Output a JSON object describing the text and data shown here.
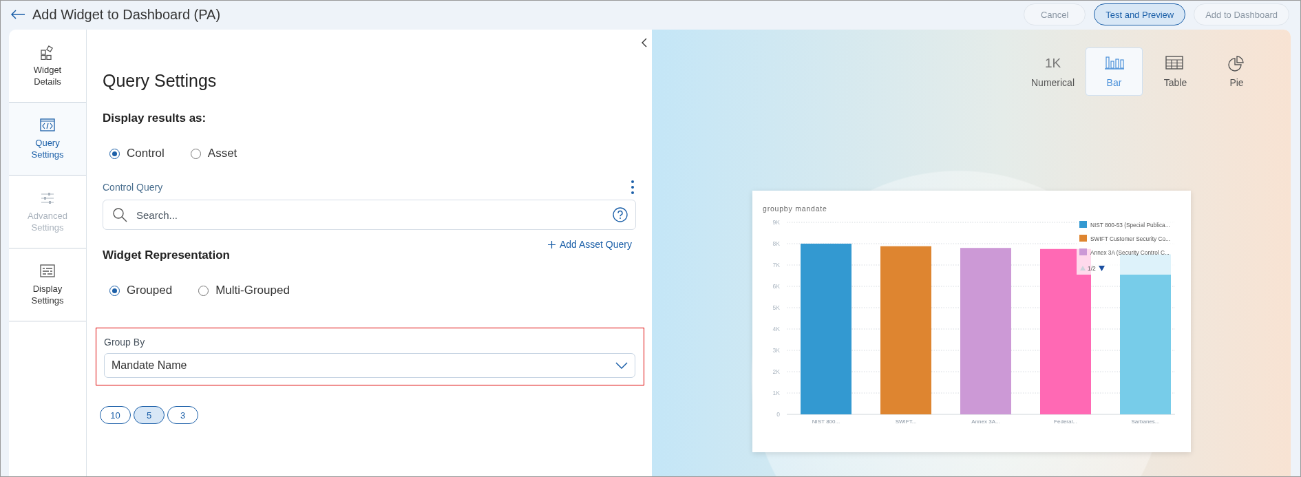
{
  "header": {
    "title": "Add Widget to Dashboard (PA)",
    "buttons": [
      {
        "label": "Cancel",
        "kind": "outline",
        "disabled": true
      },
      {
        "label": "Test and Preview",
        "kind": "primary",
        "disabled": false
      },
      {
        "label": "Add to Dashboard",
        "kind": "outline",
        "disabled": true
      }
    ]
  },
  "sidebar": {
    "items": [
      {
        "label": "Widget Details",
        "kind": "widgets",
        "selected": false,
        "disabled": false
      },
      {
        "label": "Query Settings",
        "kind": "code",
        "selected": true,
        "disabled": false
      },
      {
        "label": "Advanced Settings",
        "kind": "sliders",
        "selected": false,
        "disabled": true
      },
      {
        "label": "Display Settings",
        "kind": "list",
        "selected": false,
        "disabled": false
      }
    ]
  },
  "query_panel": {
    "title": "Query Settings",
    "display_results": {
      "label": "Display results as:",
      "options": [
        {
          "label": "Control",
          "selected": true
        },
        {
          "label": "Asset",
          "selected": false
        }
      ]
    },
    "control_query": {
      "label": "Control Query",
      "placeholder": "Search..."
    },
    "add_asset_query": "Add Asset Query",
    "widget_representation": {
      "label": "Widget Representation",
      "options": [
        {
          "label": "Grouped",
          "selected": true
        },
        {
          "label": "Multi-Grouped",
          "selected": false
        }
      ]
    },
    "group_by": {
      "label": "Group By",
      "value": "Mandate Name"
    },
    "limits": [
      {
        "label": "10",
        "selected": false
      },
      {
        "label": "5",
        "selected": true
      },
      {
        "label": "3",
        "selected": false
      }
    ]
  },
  "preview": {
    "chart_types": [
      {
        "label": "Numerical",
        "icon_text": "1K",
        "kind": "numerical",
        "selected": false
      },
      {
        "label": "Bar",
        "kind": "bar",
        "selected": true
      },
      {
        "label": "Table",
        "kind": "table",
        "selected": false
      },
      {
        "label": "Pie",
        "kind": "pie",
        "selected": false
      }
    ],
    "chart_data": {
      "type": "bar",
      "title": "groupby mandate",
      "categories": [
        "NIST 800...",
        "SWIFT...",
        "Annex 3A...",
        "Federal...",
        "Sarbanes..."
      ],
      "series": [
        {
          "color": "#3399d1",
          "values": [
            8000,
            null,
            null,
            null,
            null
          ]
        },
        {
          "color": "#de8530",
          "values": [
            null,
            7880,
            null,
            null,
            null
          ]
        },
        {
          "color": "#cc99d6",
          "values": [
            null,
            null,
            7800,
            null,
            null
          ]
        },
        {
          "color": "#ff69b4",
          "values": [
            null,
            null,
            null,
            7750,
            null
          ]
        },
        {
          "color": "#77cce9",
          "values": [
            null,
            null,
            null,
            null,
            7500
          ]
        }
      ],
      "grid": true,
      "ylim": [
        0,
        9000
      ],
      "yticks": [
        {
          "value": 0,
          "label": "0"
        },
        {
          "value": 1000,
          "label": "1K"
        },
        {
          "value": 2000,
          "label": "2K"
        },
        {
          "value": 3000,
          "label": "3K"
        },
        {
          "value": 4000,
          "label": "4K"
        },
        {
          "value": 5000,
          "label": "5K"
        },
        {
          "value": 6000,
          "label": "6K"
        },
        {
          "value": 7000,
          "label": "7K"
        },
        {
          "value": 8000,
          "label": "8K"
        },
        {
          "value": 9000,
          "label": "9K"
        }
      ]
    },
    "legend": {
      "items": [
        {
          "label": "NIST 800-53 (Special Publica...",
          "color": "#3399d1"
        },
        {
          "label": "SWIFT Customer Security Co...",
          "color": "#de8530"
        },
        {
          "label": "Annex 3A (Security Control C...",
          "color": "#cc99d6"
        }
      ],
      "pager": "1/2"
    }
  }
}
